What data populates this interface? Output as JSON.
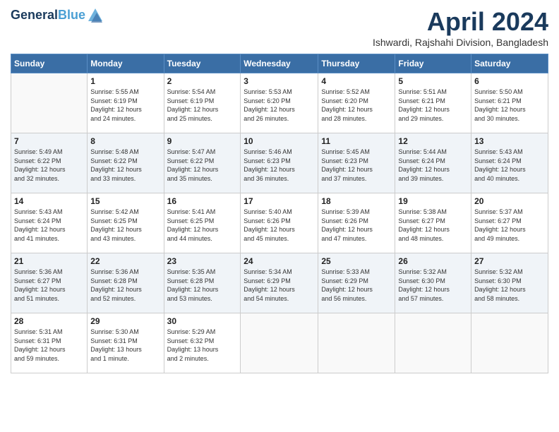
{
  "header": {
    "logo_line1": "General",
    "logo_line2": "Blue",
    "month_title": "April 2024",
    "location": "Ishwardi, Rajshahi Division, Bangladesh"
  },
  "days_of_week": [
    "Sunday",
    "Monday",
    "Tuesday",
    "Wednesday",
    "Thursday",
    "Friday",
    "Saturday"
  ],
  "weeks": [
    [
      {
        "day": "",
        "info": ""
      },
      {
        "day": "1",
        "info": "Sunrise: 5:55 AM\nSunset: 6:19 PM\nDaylight: 12 hours\nand 24 minutes."
      },
      {
        "day": "2",
        "info": "Sunrise: 5:54 AM\nSunset: 6:19 PM\nDaylight: 12 hours\nand 25 minutes."
      },
      {
        "day": "3",
        "info": "Sunrise: 5:53 AM\nSunset: 6:20 PM\nDaylight: 12 hours\nand 26 minutes."
      },
      {
        "day": "4",
        "info": "Sunrise: 5:52 AM\nSunset: 6:20 PM\nDaylight: 12 hours\nand 28 minutes."
      },
      {
        "day": "5",
        "info": "Sunrise: 5:51 AM\nSunset: 6:21 PM\nDaylight: 12 hours\nand 29 minutes."
      },
      {
        "day": "6",
        "info": "Sunrise: 5:50 AM\nSunset: 6:21 PM\nDaylight: 12 hours\nand 30 minutes."
      }
    ],
    [
      {
        "day": "7",
        "info": "Sunrise: 5:49 AM\nSunset: 6:22 PM\nDaylight: 12 hours\nand 32 minutes."
      },
      {
        "day": "8",
        "info": "Sunrise: 5:48 AM\nSunset: 6:22 PM\nDaylight: 12 hours\nand 33 minutes."
      },
      {
        "day": "9",
        "info": "Sunrise: 5:47 AM\nSunset: 6:22 PM\nDaylight: 12 hours\nand 35 minutes."
      },
      {
        "day": "10",
        "info": "Sunrise: 5:46 AM\nSunset: 6:23 PM\nDaylight: 12 hours\nand 36 minutes."
      },
      {
        "day": "11",
        "info": "Sunrise: 5:45 AM\nSunset: 6:23 PM\nDaylight: 12 hours\nand 37 minutes."
      },
      {
        "day": "12",
        "info": "Sunrise: 5:44 AM\nSunset: 6:24 PM\nDaylight: 12 hours\nand 39 minutes."
      },
      {
        "day": "13",
        "info": "Sunrise: 5:43 AM\nSunset: 6:24 PM\nDaylight: 12 hours\nand 40 minutes."
      }
    ],
    [
      {
        "day": "14",
        "info": "Sunrise: 5:43 AM\nSunset: 6:24 PM\nDaylight: 12 hours\nand 41 minutes."
      },
      {
        "day": "15",
        "info": "Sunrise: 5:42 AM\nSunset: 6:25 PM\nDaylight: 12 hours\nand 43 minutes."
      },
      {
        "day": "16",
        "info": "Sunrise: 5:41 AM\nSunset: 6:25 PM\nDaylight: 12 hours\nand 44 minutes."
      },
      {
        "day": "17",
        "info": "Sunrise: 5:40 AM\nSunset: 6:26 PM\nDaylight: 12 hours\nand 45 minutes."
      },
      {
        "day": "18",
        "info": "Sunrise: 5:39 AM\nSunset: 6:26 PM\nDaylight: 12 hours\nand 47 minutes."
      },
      {
        "day": "19",
        "info": "Sunrise: 5:38 AM\nSunset: 6:27 PM\nDaylight: 12 hours\nand 48 minutes."
      },
      {
        "day": "20",
        "info": "Sunrise: 5:37 AM\nSunset: 6:27 PM\nDaylight: 12 hours\nand 49 minutes."
      }
    ],
    [
      {
        "day": "21",
        "info": "Sunrise: 5:36 AM\nSunset: 6:27 PM\nDaylight: 12 hours\nand 51 minutes."
      },
      {
        "day": "22",
        "info": "Sunrise: 5:36 AM\nSunset: 6:28 PM\nDaylight: 12 hours\nand 52 minutes."
      },
      {
        "day": "23",
        "info": "Sunrise: 5:35 AM\nSunset: 6:28 PM\nDaylight: 12 hours\nand 53 minutes."
      },
      {
        "day": "24",
        "info": "Sunrise: 5:34 AM\nSunset: 6:29 PM\nDaylight: 12 hours\nand 54 minutes."
      },
      {
        "day": "25",
        "info": "Sunrise: 5:33 AM\nSunset: 6:29 PM\nDaylight: 12 hours\nand 56 minutes."
      },
      {
        "day": "26",
        "info": "Sunrise: 5:32 AM\nSunset: 6:30 PM\nDaylight: 12 hours\nand 57 minutes."
      },
      {
        "day": "27",
        "info": "Sunrise: 5:32 AM\nSunset: 6:30 PM\nDaylight: 12 hours\nand 58 minutes."
      }
    ],
    [
      {
        "day": "28",
        "info": "Sunrise: 5:31 AM\nSunset: 6:31 PM\nDaylight: 12 hours\nand 59 minutes."
      },
      {
        "day": "29",
        "info": "Sunrise: 5:30 AM\nSunset: 6:31 PM\nDaylight: 13 hours\nand 1 minute."
      },
      {
        "day": "30",
        "info": "Sunrise: 5:29 AM\nSunset: 6:32 PM\nDaylight: 13 hours\nand 2 minutes."
      },
      {
        "day": "",
        "info": ""
      },
      {
        "day": "",
        "info": ""
      },
      {
        "day": "",
        "info": ""
      },
      {
        "day": "",
        "info": ""
      }
    ]
  ]
}
